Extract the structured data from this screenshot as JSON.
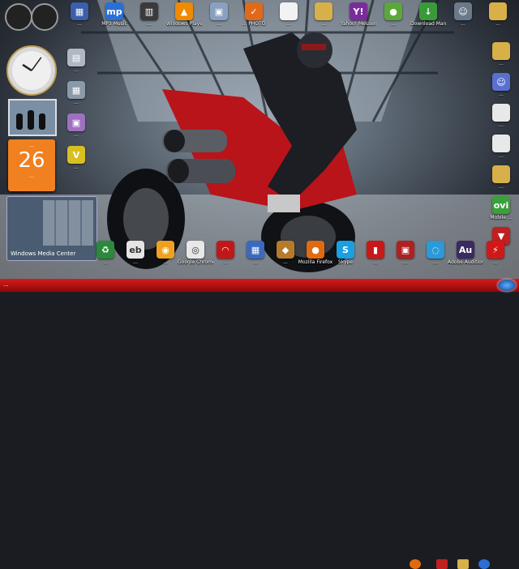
{
  "desktop_icons": [
    {
      "label": "...",
      "color": "#3b5fa8",
      "glyph": "▦",
      "icon": "app-icon"
    },
    {
      "label": "MP3 Music",
      "color": "#2a6fd6",
      "glyph": "mp",
      "icon": "music-icon"
    },
    {
      "label": "...",
      "color": "#3a3a3a",
      "glyph": "▥",
      "icon": "app-icon"
    },
    {
      "label": "Windows Player",
      "color": "#f08a00",
      "glyph": "▲",
      "icon": "vlc-icon"
    },
    {
      "label": "...",
      "color": "#8aa0c0",
      "glyph": "▣",
      "icon": "app-icon"
    },
    {
      "label": "... PHOTO",
      "color": "#e06a1a",
      "glyph": "✓",
      "icon": "check-icon"
    },
    {
      "label": "...",
      "color": "#f2f2f2",
      "glyph": "",
      "icon": "document-icon"
    },
    {
      "label": "...",
      "color": "#d8b04a",
      "glyph": "",
      "icon": "folder-icon"
    },
    {
      "label": "Yahoo! Messenger",
      "color": "#7b2c9c",
      "glyph": "Y!",
      "icon": "yahoo-icon"
    },
    {
      "label": "...",
      "color": "#5aa83a",
      "glyph": "●",
      "icon": "app-icon"
    },
    {
      "label": "Download Manager",
      "color": "#3a9a3a",
      "glyph": "↓",
      "icon": "download-icon"
    },
    {
      "label": "...",
      "color": "#6b7a8a",
      "glyph": "☺",
      "icon": "user-icon"
    },
    {
      "label": "...",
      "color": "#d8b04a",
      "glyph": "",
      "icon": "folder-icon"
    }
  ],
  "left_icons": [
    {
      "label": "...",
      "color": "#b0b8c4",
      "glyph": "▤",
      "icon": "computer-icon"
    },
    {
      "label": "...",
      "color": "#8a9aaa",
      "glyph": "▦",
      "icon": "network-icon"
    },
    {
      "label": "...",
      "color": "#a070c0",
      "glyph": "▣",
      "icon": "app-icon"
    },
    {
      "label": "...",
      "color": "#d8c020",
      "glyph": "V",
      "icon": "app-icon"
    }
  ],
  "right_icons": [
    {
      "label": "...",
      "color": "#d8b04a",
      "glyph": "",
      "icon": "folder-icon"
    },
    {
      "label": "...",
      "color": "#5a70d0",
      "glyph": "☺",
      "icon": "user-icon"
    },
    {
      "label": "...",
      "color": "#e8e8e8",
      "glyph": "",
      "icon": "document-icon"
    },
    {
      "label": "...",
      "color": "#e8e8e8",
      "glyph": "",
      "icon": "document-icon"
    },
    {
      "label": "...",
      "color": "#d8b04a",
      "glyph": "",
      "icon": "folder-icon"
    },
    {
      "label": "Mobile ...",
      "color": "#3aa03a",
      "glyph": "ovi",
      "icon": "ovi-icon"
    },
    {
      "label": "...",
      "color": "#c02020",
      "glyph": "▼",
      "icon": "download-icon"
    }
  ],
  "bottom_icons": [
    {
      "label": "...",
      "color": "#2a8a3a",
      "glyph": "♻",
      "icon": "app-icon"
    },
    {
      "label": "...",
      "color": "#e4e4e4",
      "glyph": "eb",
      "icon": "ebay-icon"
    },
    {
      "label": "...",
      "color": "#f0a020",
      "glyph": "◉",
      "icon": "app-icon"
    },
    {
      "label": "Google Chrome",
      "color": "#e8e8e8",
      "glyph": "◎",
      "icon": "chrome-icon"
    },
    {
      "label": "...",
      "color": "#c01818",
      "glyph": "◠",
      "icon": "app-icon"
    },
    {
      "label": "...",
      "color": "#3a6ac0",
      "glyph": "▦",
      "icon": "app-icon"
    },
    {
      "label": "...",
      "color": "#b87a2a",
      "glyph": "◆",
      "icon": "app-icon"
    },
    {
      "label": "Mozilla Firefox",
      "color": "#e06a10",
      "glyph": "●",
      "icon": "firefox-icon"
    },
    {
      "label": "Skype",
      "color": "#1aa0e0",
      "glyph": "S",
      "icon": "skype-icon"
    },
    {
      "label": "...",
      "color": "#c81818",
      "glyph": "▮",
      "icon": "app-icon"
    },
    {
      "label": "...",
      "color": "#b02020",
      "glyph": "▣",
      "icon": "app-icon"
    },
    {
      "label": "...",
      "color": "#2a9ad8",
      "glyph": "◌",
      "icon": "app-icon"
    },
    {
      "label": "Adobe Audition",
      "color": "#3a2a60",
      "glyph": "Au",
      "icon": "audition-icon"
    },
    {
      "label": "...",
      "color": "#d01818",
      "glyph": "⚡",
      "icon": "pdf-icon"
    }
  ],
  "calendar": {
    "weekday": "...",
    "day": "26",
    "month": "..."
  },
  "media_center": {
    "title": "Windows Media Center"
  },
  "clock": {
    "hour": 10,
    "minute": 6
  },
  "taskbar": {
    "time": "..."
  }
}
